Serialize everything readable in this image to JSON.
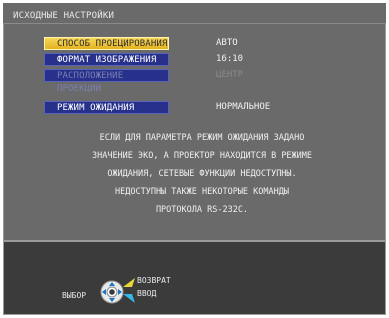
{
  "window": {
    "title": "ИСХОДНЫЕ НАСТРОЙКИ"
  },
  "menu": {
    "items": [
      {
        "label": "СПОСОБ ПРОЕЦИРОВАНИЯ",
        "value": "АВТО",
        "state": "selected"
      },
      {
        "label": "ФОРМАТ ИЗОБРАЖЕНИЯ",
        "value": "16:10",
        "state": "normal"
      },
      {
        "label": "РАСПОЛОЖЕНИЕ ПРОЕКЦИИ",
        "value": "ЦЕНТР",
        "state": "disabled"
      },
      {
        "label": "РЕЖИМ ОЖИДАНИЯ",
        "value": "НОРМАЛЬНОЕ",
        "state": "normal"
      }
    ]
  },
  "message": {
    "lines": [
      "ЕСЛИ ДЛЯ ПАРАМЕТРА РЕЖИМ ОЖИДАНИЯ ЗАДАНО",
      "ЗНАЧЕНИЕ ЭКО, А ПРОЕКТОР НАХОДИТСЯ В РЕЖИМЕ",
      "ОЖИДАНИЯ, СЕТЕВЫЕ ФУНКЦИИ НЕДОСТУПНЫ.",
      "НЕДОСТУПНЫ ТАКЖЕ НЕКОТОРЫЕ КОМАНДЫ",
      "ПРОТОКОЛА RS-232C."
    ]
  },
  "footer": {
    "select_label": "ВЫБОР",
    "return_label": "ВОЗВРАТ",
    "enter_label": "ВВОД"
  },
  "colors": {
    "selected": "#e3b320",
    "item": "#27318b",
    "background": "#6a6a6a",
    "footer": "#3b3b3b",
    "return_arrow": "#e9d63a",
    "enter_arrow": "#36b7e8"
  }
}
